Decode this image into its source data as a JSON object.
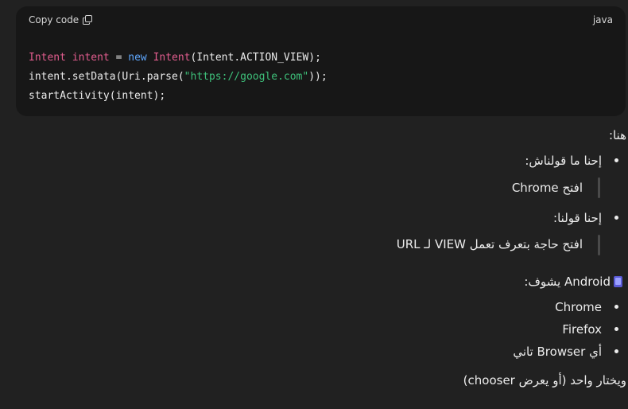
{
  "code_block": {
    "copy_label": "Copy code",
    "language": "java",
    "lines": [
      [
        {
          "t": "Intent",
          "c": "type"
        },
        {
          "t": " "
        },
        {
          "t": "intent",
          "c": "type"
        },
        {
          "t": " = "
        },
        {
          "t": "new",
          "c": "kw"
        },
        {
          "t": " "
        },
        {
          "t": "Intent",
          "c": "cls"
        },
        {
          "t": "(Intent.ACTION_VIEW);"
        }
      ],
      [
        {
          "t": "intent.setData(Uri.parse("
        },
        {
          "t": "\"https://google.com\"",
          "c": "str"
        },
        {
          "t": "));"
        }
      ],
      [
        {
          "t": "startActivity(intent);"
        }
      ]
    ]
  },
  "message": {
    "intro": "هنا:",
    "point1": "إحنا ما قولناش:",
    "quote1": "افتح Chrome",
    "point2": "إحنا قولنا:",
    "quote2": "افتح حاجة بتعرف تعمل VIEW لـ URL",
    "android_line": "Android يشوف:",
    "browsers": [
      "Chrome",
      "Firefox",
      "أي Browser تاني"
    ],
    "conclusion": "ويختار واحد (أو يعرض chooser)"
  }
}
